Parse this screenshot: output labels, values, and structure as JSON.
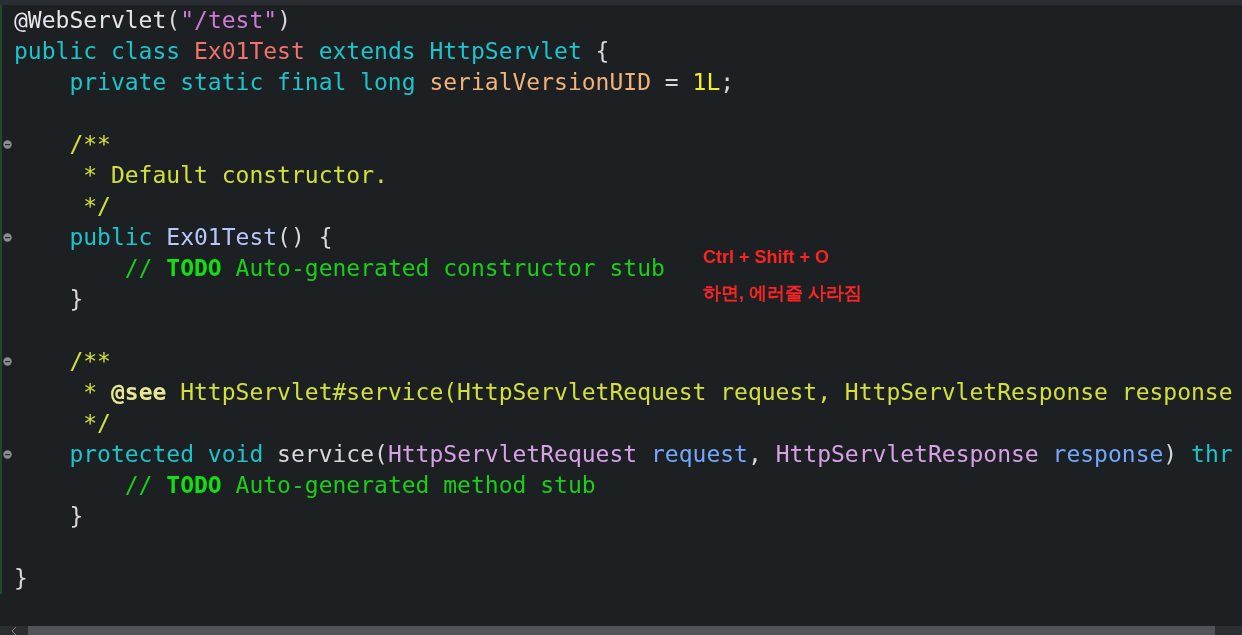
{
  "editor": {
    "lines": [
      {
        "fold_marker": false,
        "tokens": [
          {
            "kind": "annotation",
            "text": "@WebServlet"
          },
          {
            "kind": "plain",
            "text": "("
          },
          {
            "kind": "string",
            "text": "\"/test\""
          },
          {
            "kind": "plain",
            "text": ")"
          }
        ]
      },
      {
        "fold_marker": false,
        "tokens": [
          {
            "kind": "keyword",
            "text": "public class "
          },
          {
            "kind": "classname",
            "text": "Ex01Test"
          },
          {
            "kind": "keyword",
            "text": " extends "
          },
          {
            "kind": "keyword",
            "text": "HttpServlet"
          },
          {
            "kind": "plain",
            "text": " {"
          }
        ]
      },
      {
        "fold_marker": false,
        "tokens": [
          {
            "kind": "keyword",
            "text": "    private static final long "
          },
          {
            "kind": "field",
            "text": "serialVersionUID"
          },
          {
            "kind": "plain",
            "text": " = "
          },
          {
            "kind": "number",
            "text": "1L"
          },
          {
            "kind": "plain",
            "text": ";"
          }
        ]
      },
      {
        "fold_marker": false
      },
      {
        "fold_marker": true,
        "tokens": [
          {
            "kind": "javadoc",
            "text": "    /**"
          }
        ]
      },
      {
        "fold_marker": false,
        "tokens": [
          {
            "kind": "javadoc",
            "text": "     * Default constructor."
          }
        ]
      },
      {
        "fold_marker": false,
        "tokens": [
          {
            "kind": "javadoc",
            "text": "     */"
          }
        ]
      },
      {
        "fold_marker": true,
        "tokens": [
          {
            "kind": "keyword",
            "text": "    public "
          },
          {
            "kind": "method",
            "text": "Ex01Test"
          },
          {
            "kind": "plain",
            "text": "() {"
          }
        ]
      },
      {
        "fold_marker": false,
        "tokens": [
          {
            "kind": "comment",
            "text": "        // "
          },
          {
            "kind": "todo",
            "text": "TODO"
          },
          {
            "kind": "comment",
            "text": " Auto-generated constructor stub"
          }
        ]
      },
      {
        "fold_marker": false,
        "tokens": [
          {
            "kind": "plain",
            "text": "    }"
          }
        ]
      },
      {
        "fold_marker": false
      },
      {
        "fold_marker": true,
        "tokens": [
          {
            "kind": "javadoc",
            "text": "    /**"
          }
        ]
      },
      {
        "fold_marker": false,
        "tokens": [
          {
            "kind": "javadoc",
            "text": "     * "
          },
          {
            "kind": "javadoc_tag",
            "text": "@see"
          },
          {
            "kind": "javadoc",
            "text": " HttpServlet#service(HttpServletRequest request, HttpServletResponse response"
          }
        ]
      },
      {
        "fold_marker": false,
        "tokens": [
          {
            "kind": "javadoc",
            "text": "     */"
          }
        ]
      },
      {
        "fold_marker": true,
        "tokens": [
          {
            "kind": "keyword",
            "text": "    protected void "
          },
          {
            "kind": "plain",
            "text": "service("
          },
          {
            "kind": "type",
            "text": "HttpServletRequest"
          },
          {
            "kind": "param",
            "text": " request"
          },
          {
            "kind": "plain",
            "text": ", "
          },
          {
            "kind": "type",
            "text": "HttpServletResponse"
          },
          {
            "kind": "param",
            "text": " response"
          },
          {
            "kind": "plain",
            "text": ") "
          },
          {
            "kind": "keyword",
            "text": "thr"
          }
        ]
      },
      {
        "fold_marker": false,
        "tokens": [
          {
            "kind": "comment",
            "text": "        // "
          },
          {
            "kind": "todo",
            "text": "TODO"
          },
          {
            "kind": "comment",
            "text": " Auto-generated method stub"
          }
        ]
      },
      {
        "fold_marker": false,
        "tokens": [
          {
            "kind": "plain",
            "text": "    }"
          }
        ]
      },
      {
        "fold_marker": false
      },
      {
        "fold_marker": false,
        "tokens": [
          {
            "kind": "plain",
            "text": "}"
          }
        ]
      }
    ]
  },
  "note": {
    "lines": [
      "Ctrl + Shift + O",
      "하면, 에러줄 사라짐"
    ]
  }
}
